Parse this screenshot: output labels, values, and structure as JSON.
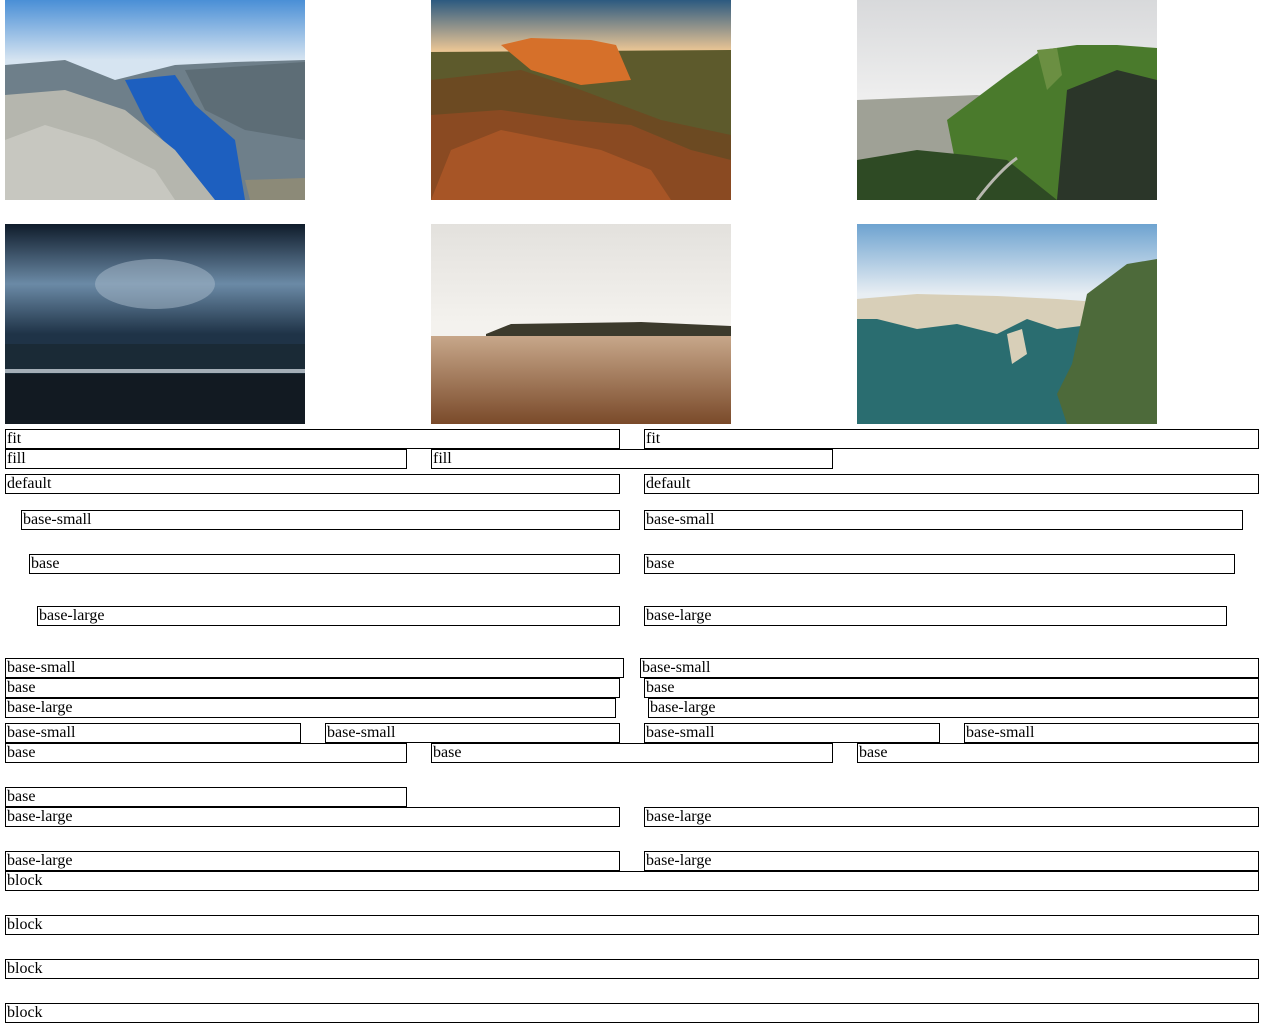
{
  "photos": [
    {
      "name": "fjord-photo",
      "sky": "#5d97d6",
      "sky2": "#d8e6f2",
      "land": "#a3a39c",
      "accent": "#1c62c4"
    },
    {
      "name": "sunset-mesa-photo",
      "sky": "#2f5f84",
      "sky2": "#f2c48a",
      "land": "#7a3d1c",
      "accent": "#d8791f"
    },
    {
      "name": "green-cliffs-photo",
      "sky": "#d2d4d6",
      "sky2": "#f0f0f0",
      "land": "#3f6a2c",
      "accent": "#2b3a2a"
    },
    {
      "name": "stormy-sea-photo",
      "sky": "#1b2f45",
      "sky2": "#5b7a94",
      "land": "#141c24",
      "accent": "#c7d0d8"
    },
    {
      "name": "beach-reflection-photo",
      "sky": "#e6e3de",
      "sky2": "#f6f4f0",
      "land": "#8f5f3c",
      "accent": "#3c3a2c"
    },
    {
      "name": "coastal-arches-photo",
      "sky": "#8cb6d8",
      "sky2": "#e8eef3",
      "land": "#2c6b6e",
      "accent": "#d9cfb9"
    }
  ],
  "labels": {
    "fit": "fit",
    "fill": "fill",
    "default": "default",
    "base_small": "base-small",
    "base": "base",
    "base_large": "base-large",
    "block": "block"
  }
}
